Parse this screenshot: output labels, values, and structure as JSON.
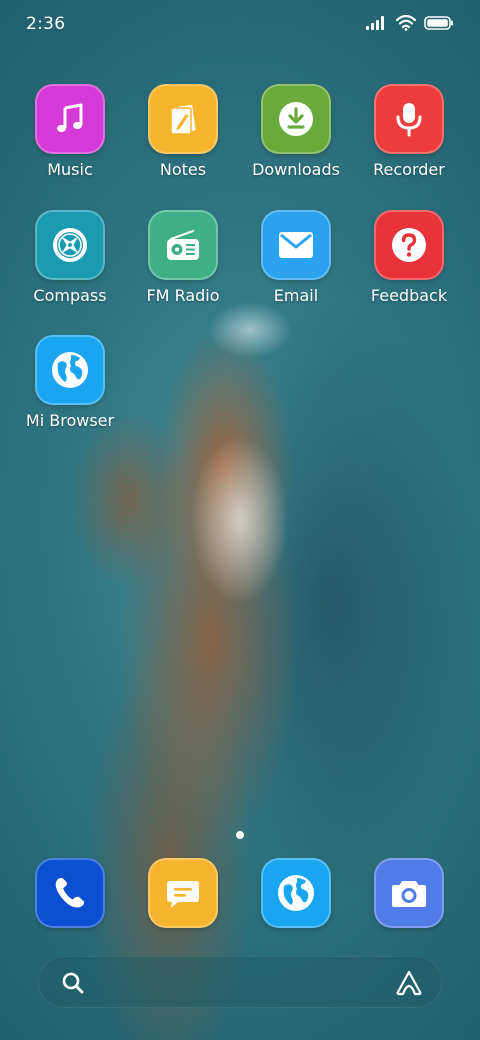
{
  "status_bar": {
    "time": "2:36",
    "icons": [
      "signal-icon",
      "wifi-icon",
      "battery-icon"
    ]
  },
  "apps": [
    {
      "id": "music",
      "label": "Music",
      "color": "#d63ad6",
      "icon": "music-note-icon"
    },
    {
      "id": "notes",
      "label": "Notes",
      "color": "#f7b42e",
      "icon": "notes-pencil-icon"
    },
    {
      "id": "downloads",
      "label": "Downloads",
      "color": "#6aaa3a",
      "icon": "download-icon"
    },
    {
      "id": "recorder",
      "label": "Recorder",
      "color": "#ef3d3d",
      "icon": "microphone-icon"
    },
    {
      "id": "compass",
      "label": "Compass",
      "color": "#1a9bb0",
      "icon": "compass-icon"
    },
    {
      "id": "fm-radio",
      "label": "FM Radio",
      "color": "#3fb086",
      "icon": "radio-icon"
    },
    {
      "id": "email",
      "label": "Email",
      "color": "#2aa2ef",
      "icon": "envelope-icon"
    },
    {
      "id": "feedback",
      "label": "Feedback",
      "color": "#e8333a",
      "icon": "question-icon"
    },
    {
      "id": "mi-browser",
      "label": "Mi Browser",
      "color": "#1aa5f0",
      "icon": "globe-icon"
    }
  ],
  "dock": [
    {
      "id": "phone",
      "color": "#0a4fcf",
      "icon": "phone-icon"
    },
    {
      "id": "messaging",
      "color": "#f7b42e",
      "icon": "message-icon"
    },
    {
      "id": "browser",
      "color": "#1aa5f0",
      "icon": "globe-icon"
    },
    {
      "id": "camera",
      "color": "#4f7ce6",
      "icon": "camera-icon"
    }
  ],
  "page_indicator": {
    "current": 1,
    "total": 1
  },
  "search_bar": {
    "icons": [
      "search-icon",
      "assistant-icon"
    ]
  }
}
